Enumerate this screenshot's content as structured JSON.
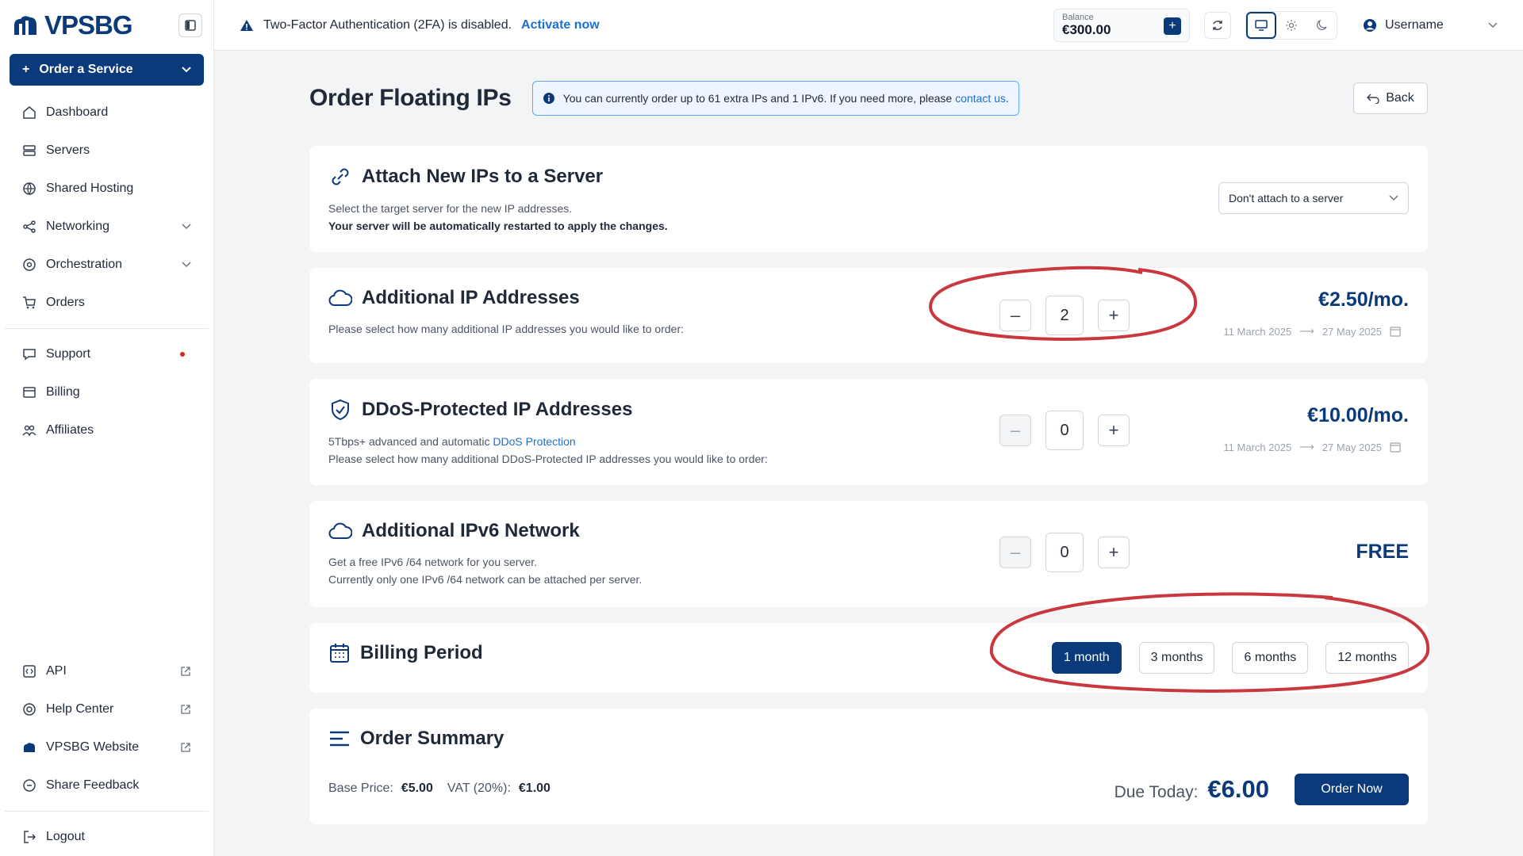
{
  "sidebar": {
    "logo_text": "VPSBG",
    "order_button": "Order a Service",
    "items": [
      {
        "label": "Dashboard",
        "icon": "home-icon"
      },
      {
        "label": "Servers",
        "icon": "server-icon"
      },
      {
        "label": "Shared Hosting",
        "icon": "globe-icon"
      },
      {
        "label": "Networking",
        "icon": "share-icon"
      },
      {
        "label": "Orchestration",
        "icon": "orchestration-icon"
      },
      {
        "label": "Orders",
        "icon": "cart-icon"
      },
      {
        "label": "Support",
        "icon": "chat-icon"
      },
      {
        "label": "Billing",
        "icon": "billing-icon"
      },
      {
        "label": "Affiliates",
        "icon": "users-icon"
      }
    ],
    "bottom_items": [
      {
        "label": "API"
      },
      {
        "label": "Help Center"
      },
      {
        "label": "VPSBG Website"
      },
      {
        "label": "Share Feedback"
      },
      {
        "label": "Logout"
      }
    ]
  },
  "header": {
    "tfa_text": "Two-Factor Authentication (2FA) is disabled.",
    "tfa_link": "Activate now",
    "balance_label": "Balance",
    "balance_value": "€300.00",
    "username": "Username"
  },
  "main": {
    "title": "Order Floating IPs",
    "info_text": "You can currently order up to 61 extra IPs and 1 IPv6. If you need more, please",
    "info_link": "contact us",
    "info_end": ".",
    "back": "Back",
    "attach": {
      "title": "Attach New IPs to a Server",
      "desc": "Select the target server for the new IP addresses.",
      "note": "Your server will be automatically restarted to apply the changes.",
      "select_value": "Don't attach to a server"
    },
    "additional_ip": {
      "title": "Additional IP Addresses",
      "desc": "Please select how many additional IP addresses you would like to order:",
      "quantity": "2",
      "price": "€2.50/mo.",
      "date_from": "11 March 2025",
      "date_to": "27 May 2025"
    },
    "ddos_ip": {
      "title": "DDoS-Protected IP Addresses",
      "desc_prefix": "5Tbps+ advanced and automatic",
      "desc_link": "DDoS Protection",
      "desc2": "Please select how many additional DDoS-Protected IP addresses you would like to order:",
      "quantity": "0",
      "price": "€10.00/mo.",
      "date_from": "11 March 2025",
      "date_to": "27 May 2025"
    },
    "ipv6": {
      "title": "Additional IPv6 Network",
      "desc": "Get a free IPv6 /64 network for you server.",
      "desc2": "Currently only one IPv6 /64 network can be attached per server.",
      "quantity": "0",
      "price": "FREE"
    },
    "billing": {
      "title": "Billing Period",
      "options": [
        "1 month",
        "3 months",
        "6 months",
        "12 months"
      ],
      "selected": "1 month"
    },
    "summary": {
      "title": "Order Summary",
      "base_label": "Base Price:",
      "base_value": "€5.00",
      "vat_label": "VAT (20%):",
      "vat_value": "€1.00",
      "due_label": "Due Today:",
      "due_value": "€6.00",
      "order_button": "Order Now"
    }
  },
  "colors": {
    "accent": "#0b3a7a",
    "link": "#1d6fd1",
    "annotation": "#c9373f"
  }
}
